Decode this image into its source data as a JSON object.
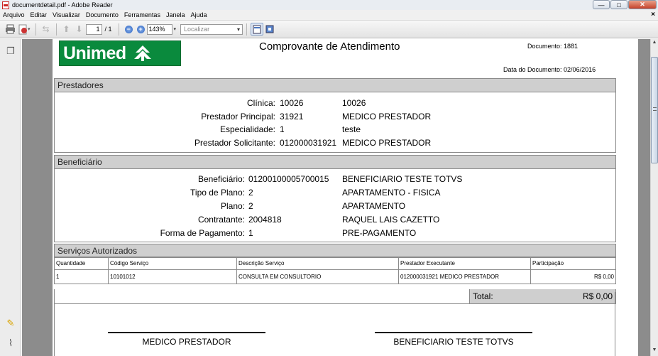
{
  "window": {
    "title": "documentdetail.pdf - Adobe Reader",
    "min_label": "—",
    "max_label": "□",
    "close_label": "✕"
  },
  "menu": [
    "Arquivo",
    "Editar",
    "Visualizar",
    "Documento",
    "Ferramentas",
    "Janela",
    "Ajuda"
  ],
  "menu_close": "×",
  "toolbar": {
    "page_current": "1",
    "page_total": "/ 1",
    "zoom": "143%",
    "find_placeholder": "Localizar"
  },
  "document": {
    "logo": "Unimed",
    "title": "Comprovante de Atendimento",
    "number": "Documento: 1881",
    "date": "Data do Documento: 02/06/2016",
    "prestadores": {
      "heading": "Prestadores",
      "rows": [
        {
          "label": "Clínica:",
          "code": "10026",
          "value": "10026"
        },
        {
          "label": "Prestador Principal:",
          "code": "31921",
          "value": "MEDICO PRESTADOR"
        },
        {
          "label": "Especialidade:",
          "code": "1",
          "value": "teste"
        },
        {
          "label": "Prestador Solicitante:",
          "code": "012000031921",
          "value": "MEDICO PRESTADOR"
        }
      ]
    },
    "beneficiario": {
      "heading": "Beneficiário",
      "rows": [
        {
          "label": "Beneficiário:",
          "code": "01200100005700015",
          "value": "BENEFICIARIO TESTE TOTVS"
        },
        {
          "label": "Tipo de Plano:",
          "code": "2",
          "value": "APARTAMENTO - FISICA"
        },
        {
          "label": "Plano:",
          "code": "2",
          "value": "APARTAMENTO"
        },
        {
          "label": "Contratante:",
          "code": "2004818",
          "value": "RAQUEL LAIS CAZETTO"
        },
        {
          "label": "Forma de Pagamento:",
          "code": "1",
          "value": "PRE-PAGAMENTO"
        }
      ]
    },
    "servicos": {
      "heading": "Serviços Autorizados",
      "columns": [
        "Quantidade",
        "Código Serviço",
        "Descrição Serviço",
        "Prestador Executante",
        "Participação"
      ],
      "rows": [
        [
          "1",
          "10101012",
          "CONSULTA EM CONSULTORIO",
          "012000031921 MEDICO PRESTADOR",
          "R$ 0,00"
        ]
      ],
      "total_label": "Total:",
      "total_value": "R$ 0,00"
    },
    "signatures": [
      "MEDICO PRESTADOR",
      "BENEFICIARIO TESTE TOTVS"
    ]
  }
}
